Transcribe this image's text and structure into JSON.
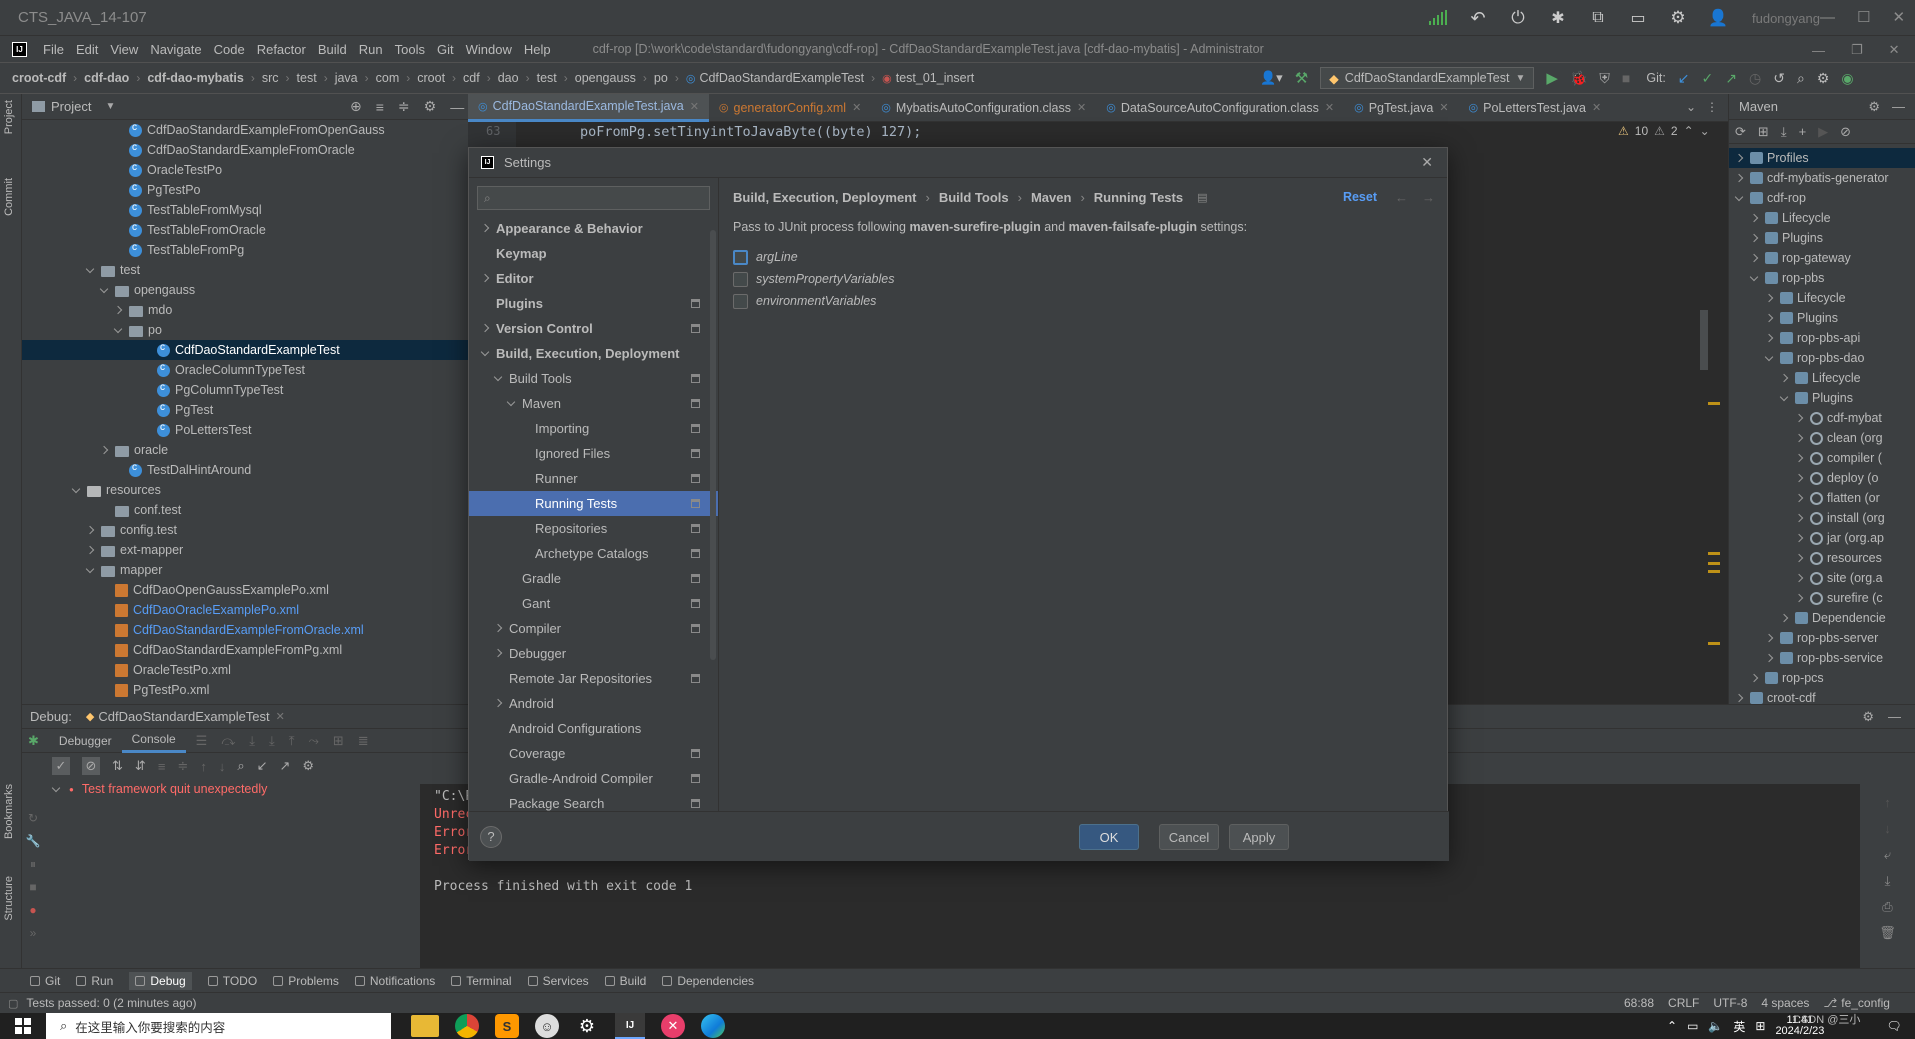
{
  "window": {
    "title": "CTS_JAVA_14-107",
    "user": "fudongyang"
  },
  "menu": [
    "File",
    "Edit",
    "View",
    "Navigate",
    "Code",
    "Refactor",
    "Build",
    "Run",
    "Tools",
    "Git",
    "Window",
    "Help"
  ],
  "ide_title": "cdf-rop [D:\\work\\code\\standard\\fudongyang\\cdf-rop] - CdfDaoStandardExampleTest.java [cdf-dao-mybatis] - Administrator",
  "breadcrumbs": [
    "croot-cdf",
    "cdf-dao",
    "cdf-dao-mybatis",
    "src",
    "test",
    "java",
    "com",
    "croot",
    "cdf",
    "dao",
    "test",
    "opengauss",
    "po",
    "CdfDaoStandardExampleTest",
    "test_01_insert"
  ],
  "run_config": "CdfDaoStandardExampleTest",
  "git_label": "Git:",
  "project": {
    "title": "Project",
    "rows": [
      {
        "t": "CdfDaoStandardExampleFromOpenGauss",
        "ind": 6,
        "k": "cls"
      },
      {
        "t": "CdfDaoStandardExampleFromOracle",
        "ind": 6,
        "k": "cls"
      },
      {
        "t": "OracleTestPo",
        "ind": 6,
        "k": "cls"
      },
      {
        "t": "PgTestPo",
        "ind": 6,
        "k": "cls"
      },
      {
        "t": "TestTableFromMysql",
        "ind": 6,
        "k": "cls"
      },
      {
        "t": "TestTableFromOracle",
        "ind": 6,
        "k": "cls"
      },
      {
        "t": "TestTableFromPg",
        "ind": 6,
        "k": "cls"
      },
      {
        "t": "test",
        "ind": 4,
        "k": "dir",
        "open": true
      },
      {
        "t": "opengauss",
        "ind": 5,
        "k": "dir",
        "open": true
      },
      {
        "t": "mdo",
        "ind": 6,
        "k": "dir"
      },
      {
        "t": "po",
        "ind": 6,
        "k": "dir",
        "open": true
      },
      {
        "t": "CdfDaoStandardExampleTest",
        "ind": 8,
        "k": "cls",
        "sel": true
      },
      {
        "t": "OracleColumnTypeTest",
        "ind": 8,
        "k": "cls"
      },
      {
        "t": "PgColumnTypeTest",
        "ind": 8,
        "k": "cls"
      },
      {
        "t": "PgTest",
        "ind": 8,
        "k": "cls"
      },
      {
        "t": "PoLettersTest",
        "ind": 8,
        "k": "cls"
      },
      {
        "t": "oracle",
        "ind": 5,
        "k": "dir"
      },
      {
        "t": "TestDalHintAround",
        "ind": 6,
        "k": "cls"
      },
      {
        "t": "resources",
        "ind": 3,
        "k": "res",
        "open": true
      },
      {
        "t": "conf.test",
        "ind": 5,
        "k": "dirleaf"
      },
      {
        "t": "config.test",
        "ind": 4,
        "k": "dir"
      },
      {
        "t": "ext-mapper",
        "ind": 4,
        "k": "dir"
      },
      {
        "t": "mapper",
        "ind": 4,
        "k": "dir",
        "open": true
      },
      {
        "t": "CdfDaoOpenGaussExamplePo.xml",
        "ind": 5,
        "k": "xml"
      },
      {
        "t": "CdfDaoOracleExamplePo.xml",
        "ind": 5,
        "k": "xml",
        "blue": true
      },
      {
        "t": "CdfDaoStandardExampleFromOracle.xml",
        "ind": 5,
        "k": "xml",
        "blue": true
      },
      {
        "t": "CdfDaoStandardExampleFromPg.xml",
        "ind": 5,
        "k": "xml"
      },
      {
        "t": "OracleTestPo.xml",
        "ind": 5,
        "k": "xml"
      },
      {
        "t": "PgTestPo.xml",
        "ind": 5,
        "k": "xml"
      }
    ]
  },
  "editor": {
    "tabs": [
      {
        "t": "CdfDaoStandardExampleTest.java",
        "active": true
      },
      {
        "t": "generatorConfig.xml"
      },
      {
        "t": "MybatisAutoConfiguration.class"
      },
      {
        "t": "DataSourceAutoConfiguration.class"
      },
      {
        "t": "PgTest.java"
      },
      {
        "t": "PoLettersTest.java"
      }
    ],
    "line_no": "63",
    "code": "poFromPg.setTinyintToJavaByte((byte) 127);",
    "warnings": "10",
    "weak_warnings": "2"
  },
  "maven": {
    "title": "Maven",
    "rows": [
      {
        "t": "Profiles",
        "ind": 0,
        "sel": true
      },
      {
        "t": "cdf-mybatis-generator",
        "ind": 0
      },
      {
        "t": "cdf-rop",
        "ind": 0,
        "open": true
      },
      {
        "t": "Lifecycle",
        "ind": 1
      },
      {
        "t": "Plugins",
        "ind": 1
      },
      {
        "t": "rop-gateway",
        "ind": 1
      },
      {
        "t": "rop-pbs",
        "ind": 1,
        "open": true
      },
      {
        "t": "Lifecycle",
        "ind": 2
      },
      {
        "t": "Plugins",
        "ind": 2
      },
      {
        "t": "rop-pbs-api",
        "ind": 2
      },
      {
        "t": "rop-pbs-dao",
        "ind": 2,
        "open": true
      },
      {
        "t": "Lifecycle",
        "ind": 3
      },
      {
        "t": "Plugins",
        "ind": 3,
        "open": true
      },
      {
        "t": "cdf-mybat",
        "ind": 4,
        "g": true
      },
      {
        "t": "clean (org",
        "ind": 4,
        "g": true
      },
      {
        "t": "compiler (",
        "ind": 4,
        "g": true
      },
      {
        "t": "deploy (o",
        "ind": 4,
        "g": true
      },
      {
        "t": "flatten (or",
        "ind": 4,
        "g": true
      },
      {
        "t": "install (org",
        "ind": 4,
        "g": true
      },
      {
        "t": "jar (org.ap",
        "ind": 4,
        "g": true
      },
      {
        "t": "resources",
        "ind": 4,
        "g": true
      },
      {
        "t": "site (org.a",
        "ind": 4,
        "g": true
      },
      {
        "t": "surefire (c",
        "ind": 4,
        "g": true
      },
      {
        "t": "Dependencie",
        "ind": 3
      },
      {
        "t": "rop-pbs-server",
        "ind": 2
      },
      {
        "t": "rop-pbs-service",
        "ind": 2
      },
      {
        "t": "rop-pcs",
        "ind": 1
      },
      {
        "t": "croot-cdf",
        "ind": 0
      }
    ]
  },
  "debug": {
    "label": "Debug:",
    "session": "CdfDaoStandardExampleTest",
    "tabs": [
      "Debugger",
      "Console"
    ],
    "tree_item": "Test framework quit unexpectedly",
    "console_lines": [
      {
        "t": "\"C:\\P",
        "c": "#bbbbbb"
      },
      {
        "t": "Unrec",
        "c": "#ff6b68"
      },
      {
        "t": "Error",
        "c": "#ff6b68"
      },
      {
        "t": "Error: A fatal exception has occurred. Program will exit.",
        "c": "#ff6b68"
      },
      {
        "t": "",
        "c": "#bbbbbb"
      },
      {
        "t": "Process finished with exit code 1",
        "c": "#bbbbbb"
      }
    ]
  },
  "left_strip": [
    "Project",
    "Commit",
    "Bookmarks",
    "Structure"
  ],
  "bottom_tools": [
    "Git",
    "Run",
    "Debug",
    "TODO",
    "Problems",
    "Notifications",
    "Terminal",
    "Services",
    "Build",
    "Dependencies"
  ],
  "status": {
    "left": "Tests passed: 0 (2 minutes ago)",
    "position": "68:88",
    "line_sep": "CRLF",
    "encoding": "UTF-8",
    "indent": "4 spaces",
    "branch": "fe_config"
  },
  "dialog": {
    "title": "Settings",
    "search_placeholder": "",
    "breadcrumb": [
      "Build, Execution, Deployment",
      "Build Tools",
      "Maven",
      "Running Tests"
    ],
    "reset": "Reset",
    "description_pre": "Pass to JUnit process following ",
    "plugin1": "maven-surefire-plugin",
    "description_mid": " and ",
    "plugin2": "maven-failsafe-plugin",
    "description_post": " settings:",
    "options": [
      "argLine",
      "systemPropertyVariables",
      "environmentVariables"
    ],
    "nav": [
      {
        "t": "Appearance & Behavior",
        "ind": 0,
        "b": true,
        "arrow": "r"
      },
      {
        "t": "Keymap",
        "ind": 0,
        "b": true
      },
      {
        "t": "Editor",
        "ind": 0,
        "b": true,
        "arrow": "r"
      },
      {
        "t": "Plugins",
        "ind": 0,
        "b": true,
        "pg": true
      },
      {
        "t": "Version Control",
        "ind": 0,
        "b": true,
        "arrow": "r",
        "pg": true
      },
      {
        "t": "Build, Execution, Deployment",
        "ind": 0,
        "b": true,
        "arrow": "d"
      },
      {
        "t": "Build Tools",
        "ind": 1,
        "arrow": "d",
        "pg": true
      },
      {
        "t": "Maven",
        "ind": 2,
        "arrow": "d",
        "pg": true
      },
      {
        "t": "Importing",
        "ind": 3,
        "pg": true
      },
      {
        "t": "Ignored Files",
        "ind": 3,
        "pg": true
      },
      {
        "t": "Runner",
        "ind": 3,
        "pg": true
      },
      {
        "t": "Running Tests",
        "ind": 3,
        "pg": true,
        "sel": true
      },
      {
        "t": "Repositories",
        "ind": 3,
        "pg": true
      },
      {
        "t": "Archetype Catalogs",
        "ind": 3,
        "pg": true
      },
      {
        "t": "Gradle",
        "ind": 2,
        "pg": true
      },
      {
        "t": "Gant",
        "ind": 2,
        "pg": true
      },
      {
        "t": "Compiler",
        "ind": 1,
        "arrow": "r",
        "pg": true
      },
      {
        "t": "Debugger",
        "ind": 1,
        "arrow": "r"
      },
      {
        "t": "Remote Jar Repositories",
        "ind": 1,
        "pg": true
      },
      {
        "t": "Android",
        "ind": 1,
        "arrow": "r"
      },
      {
        "t": "Android Configurations",
        "ind": 1
      },
      {
        "t": "Coverage",
        "ind": 1,
        "pg": true
      },
      {
        "t": "Gradle-Android Compiler",
        "ind": 1,
        "pg": true
      },
      {
        "t": "Package Search",
        "ind": 1,
        "pg": true
      }
    ],
    "buttons": {
      "ok": "OK",
      "cancel": "Cancel",
      "apply": "Apply",
      "help": "?"
    }
  },
  "taskbar": {
    "search_placeholder": "在这里输入你要搜索的内容",
    "ime": "英",
    "time": "11:41",
    "date": "2024/2/23",
    "watermark": "CSDN @三小"
  },
  "colors": {
    "accent": "#4b6eaf",
    "error": "#ff6b68",
    "link": "#589df6",
    "primary_button": "#365880"
  }
}
